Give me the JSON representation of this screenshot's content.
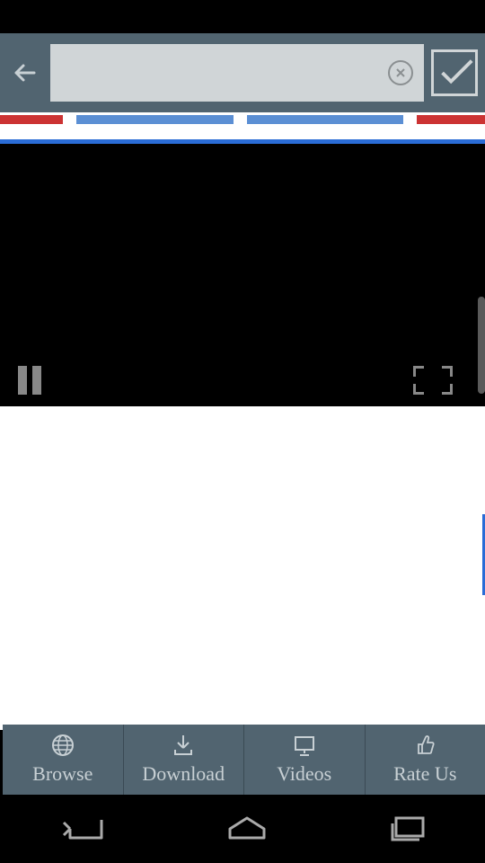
{
  "toolbar": {
    "search_value": "",
    "search_placeholder": ""
  },
  "tabs": [
    {
      "label": "Browse",
      "icon": "globe-icon"
    },
    {
      "label": "Download",
      "icon": "download-icon"
    },
    {
      "label": "Videos",
      "icon": "presentation-icon"
    },
    {
      "label": "Rate Us",
      "icon": "thumbs-up-icon"
    }
  ]
}
